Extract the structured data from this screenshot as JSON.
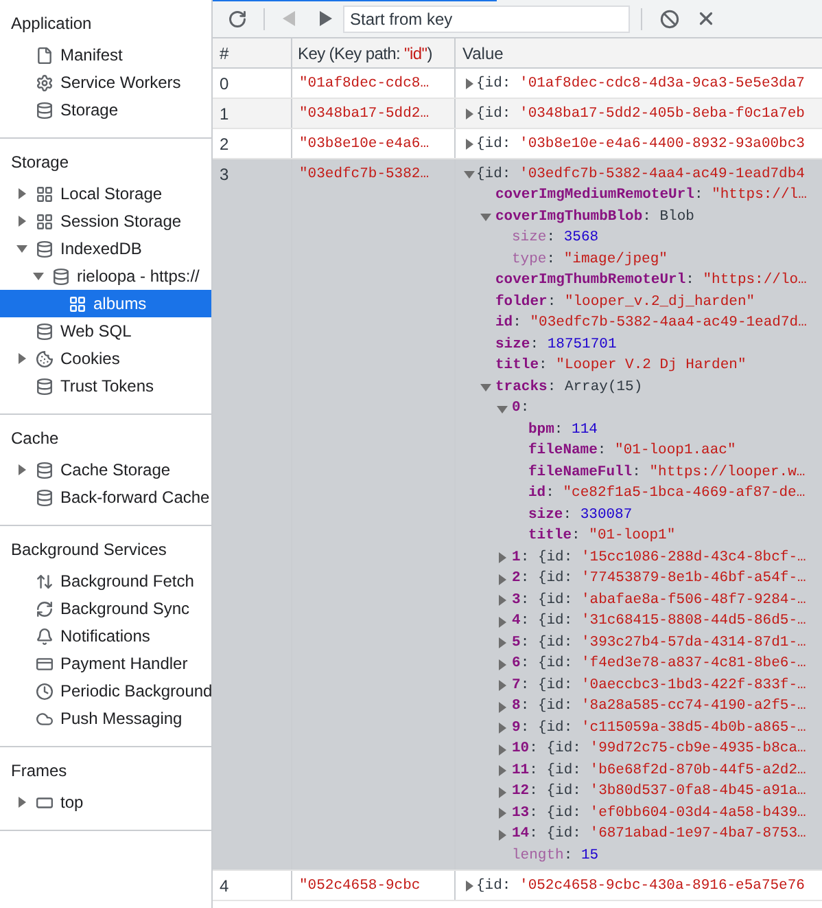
{
  "sidebar": {
    "sections": [
      {
        "title": "Application",
        "items": [
          {
            "label": "Manifest",
            "selected": false
          },
          {
            "label": "Service Workers",
            "selected": false
          },
          {
            "label": "Storage",
            "selected": false
          }
        ]
      },
      {
        "title": "Storage",
        "items": [
          {
            "label": "Local Storage",
            "selected": false,
            "expanded": false
          },
          {
            "label": "Session Storage",
            "selected": false,
            "expanded": false
          },
          {
            "label": "IndexedDB",
            "selected": false,
            "expanded": true,
            "children": [
              {
                "label": "rieloopa - https://",
                "selected": false,
                "expanded": true,
                "children": [
                  {
                    "label": "albums",
                    "selected": true
                  }
                ]
              }
            ]
          },
          {
            "label": "Web SQL",
            "selected": false
          },
          {
            "label": "Cookies",
            "selected": false,
            "expanded": false
          },
          {
            "label": "Trust Tokens",
            "selected": false
          }
        ]
      },
      {
        "title": "Cache",
        "items": [
          {
            "label": "Cache Storage",
            "selected": false,
            "expanded": false
          },
          {
            "label": "Back-forward Cache",
            "selected": false
          }
        ]
      },
      {
        "title": "Background Services",
        "items": [
          {
            "label": "Background Fetch",
            "selected": false
          },
          {
            "label": "Background Sync",
            "selected": false
          },
          {
            "label": "Notifications",
            "selected": false
          },
          {
            "label": "Payment Handler",
            "selected": false
          },
          {
            "label": "Periodic Background",
            "selected": false
          },
          {
            "label": "Push Messaging",
            "selected": false
          }
        ]
      },
      {
        "title": "Frames",
        "items": [
          {
            "label": "top",
            "selected": false,
            "expanded": false
          }
        ]
      }
    ]
  },
  "toolbar": {
    "previous_disabled": true,
    "next_disabled": false,
    "search": {
      "placeholder": "Start from key"
    }
  },
  "value_separator": ":",
  "table": {
    "columns": [
      {
        "label": "#"
      },
      {
        "label": "Key (Key path: ",
        "path": "\"id\"",
        "suffix": ")"
      },
      {
        "label": "Value"
      }
    ],
    "rows": [
      {
        "index": "0",
        "key": "\"01af8dec-cdc8…",
        "selected": false,
        "value": {
          "expanded": false,
          "prefix": "{id:",
          "preview": "'01af8dec-cdc8-4d3a-9ca3-5e5e3da7"
        }
      },
      {
        "index": "1",
        "key": "\"0348ba17-5dd2…",
        "selected": false,
        "value": {
          "expanded": false,
          "prefix": "{id:",
          "preview": "'0348ba17-5dd2-405b-8eba-f0c1a7eb"
        }
      },
      {
        "index": "2",
        "key": "\"03b8e10e-e4a6…",
        "selected": false,
        "value": {
          "expanded": false,
          "prefix": "{id:",
          "preview": "'03b8e10e-e4a6-4400-8932-93a00bc3"
        }
      },
      {
        "index": "3",
        "key": "\"03edfc7b-5382…",
        "selected": true,
        "value": {
          "expanded": true,
          "prefix": "{id:",
          "preview": "'03edfc7b-5382-4aa4-ac49-1ead7db4",
          "properties": [
            {
              "key": "coverImgMediumRemoteUrl",
              "kind": "string",
              "value": "\"https://l…"
            },
            {
              "key": "coverImgThumbBlob",
              "kind": "object",
              "value": "Blob",
              "expanded": true,
              "children": [
                {
                  "internal_key": "size",
                  "kind": "number",
                  "value": "3568"
                },
                {
                  "internal_key": "type",
                  "kind": "string",
                  "value": "\"image/jpeg\""
                }
              ]
            },
            {
              "key": "coverImgThumbRemoteUrl",
              "kind": "string",
              "value": "\"https://lo…"
            },
            {
              "key": "folder",
              "kind": "string",
              "value": "\"looper_v.2_dj_harden\""
            },
            {
              "key": "id",
              "kind": "string",
              "value": "\"03edfc7b-5382-4aa4-ac49-1ead7d…"
            },
            {
              "key": "size",
              "kind": "number",
              "value": "18751701"
            },
            {
              "key": "title",
              "kind": "string",
              "value": "\"Looper V.2 Dj Harden\""
            },
            {
              "key": "tracks",
              "kind": "object",
              "value": "Array(15)",
              "expanded": true,
              "children": [
                {
                  "key": "0",
                  "kind": "object",
                  "expanded": true,
                  "children": [
                    {
                      "key": "bpm",
                      "kind": "number",
                      "value": "114"
                    },
                    {
                      "key": "fileName",
                      "kind": "string",
                      "value": "\"01-loop1.aac\""
                    },
                    {
                      "key": "fileNameFull",
                      "kind": "string",
                      "value": "\"https://looper.w…"
                    },
                    {
                      "key": "id",
                      "kind": "string",
                      "value": "\"ce82f1a5-1bca-4669-af87-de…"
                    },
                    {
                      "key": "size",
                      "kind": "number",
                      "value": "330087"
                    },
                    {
                      "key": "title",
                      "kind": "string",
                      "value": "\"01-loop1\""
                    }
                  ]
                },
                {
                  "key": "1",
                  "kind": "preview",
                  "expanded": false,
                  "prefix": "{id:",
                  "value": "'15cc1086-288d-43c4-8bcf-…"
                },
                {
                  "key": "2",
                  "kind": "preview",
                  "expanded": false,
                  "prefix": "{id:",
                  "value": "'77453879-8e1b-46bf-a54f-…"
                },
                {
                  "key": "3",
                  "kind": "preview",
                  "expanded": false,
                  "prefix": "{id:",
                  "value": "'abafae8a-f506-48f7-9284-…"
                },
                {
                  "key": "4",
                  "kind": "preview",
                  "expanded": false,
                  "prefix": "{id:",
                  "value": "'31c68415-8808-44d5-86d5-…"
                },
                {
                  "key": "5",
                  "kind": "preview",
                  "expanded": false,
                  "prefix": "{id:",
                  "value": "'393c27b4-57da-4314-87d1-…"
                },
                {
                  "key": "6",
                  "kind": "preview",
                  "expanded": false,
                  "prefix": "{id:",
                  "value": "'f4ed3e78-a837-4c81-8be6-…"
                },
                {
                  "key": "7",
                  "kind": "preview",
                  "expanded": false,
                  "prefix": "{id:",
                  "value": "'0aeccbc3-1bd3-422f-833f-…"
                },
                {
                  "key": "8",
                  "kind": "preview",
                  "expanded": false,
                  "prefix": "{id:",
                  "value": "'8a28a585-cc74-4190-a2f5-…"
                },
                {
                  "key": "9",
                  "kind": "preview",
                  "expanded": false,
                  "prefix": "{id:",
                  "value": "'c115059a-38d5-4b0b-a865-…"
                },
                {
                  "key": "10",
                  "kind": "preview",
                  "expanded": false,
                  "prefix": "{id:",
                  "value": "'99d72c75-cb9e-4935-b8ca…"
                },
                {
                  "key": "11",
                  "kind": "preview",
                  "expanded": false,
                  "prefix": "{id:",
                  "value": "'b6e68f2d-870b-44f5-a2d2…"
                },
                {
                  "key": "12",
                  "kind": "preview",
                  "expanded": false,
                  "prefix": "{id:",
                  "value": "'3b80d537-0fa8-4b45-a91a…"
                },
                {
                  "key": "13",
                  "kind": "preview",
                  "expanded": false,
                  "prefix": "{id:",
                  "value": "'ef0bb604-03d4-4a58-b439…"
                },
                {
                  "key": "14",
                  "kind": "preview",
                  "expanded": false,
                  "prefix": "{id:",
                  "value": "'6871abad-1e97-4ba7-8753…"
                },
                {
                  "internal_key": "length",
                  "kind": "number",
                  "value": "15"
                }
              ]
            }
          ]
        }
      },
      {
        "index": "4",
        "key": "\"052c4658-9cbc",
        "selected": false,
        "value": {
          "expanded": false,
          "prefix": "{id:",
          "preview": "'052c4658-9cbc-430a-8916-e5a75e76"
        }
      }
    ]
  }
}
